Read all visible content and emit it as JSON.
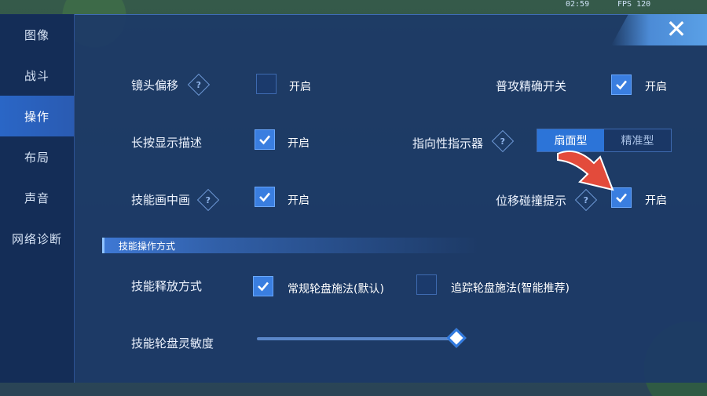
{
  "hud": {
    "time": "02:59",
    "fps": "FPS 120"
  },
  "sidebar": {
    "items": [
      {
        "label": "图像"
      },
      {
        "label": "战斗"
      },
      {
        "label": "操作",
        "active": true
      },
      {
        "label": "布局"
      },
      {
        "label": "声音"
      },
      {
        "label": "网络诊断"
      }
    ]
  },
  "close_label": "✕",
  "settings": {
    "camera_offset": {
      "label": "镜头偏移",
      "checked": false,
      "option": "开启"
    },
    "long_press_desc": {
      "label": "长按显示描述",
      "checked": true,
      "option": "开启"
    },
    "skill_pip": {
      "label": "技能画中画",
      "checked": true,
      "option": "开启"
    },
    "precise_attack": {
      "label": "普攻精确开关",
      "checked": true,
      "option": "开启"
    },
    "directional_indicator": {
      "label": "指向性指示器",
      "options": [
        "扇面型",
        "精准型"
      ],
      "selected": "扇面型"
    },
    "displacement_hint": {
      "label": "位移碰撞提示",
      "checked": true,
      "option": "开启"
    }
  },
  "section": {
    "title": "技能操作方式"
  },
  "skill_release": {
    "label": "技能释放方式",
    "option_1": {
      "text": "常规轮盘施法(默认)",
      "checked": true
    },
    "option_2": {
      "text": "追踪轮盘施法(智能推荐)",
      "checked": false
    }
  },
  "sensitivity": {
    "label": "技能轮盘灵敏度",
    "value": 1.0
  },
  "colors": {
    "panel": "#1c3868",
    "accent": "#3a7ee0",
    "arrow": "#e34b3b"
  }
}
